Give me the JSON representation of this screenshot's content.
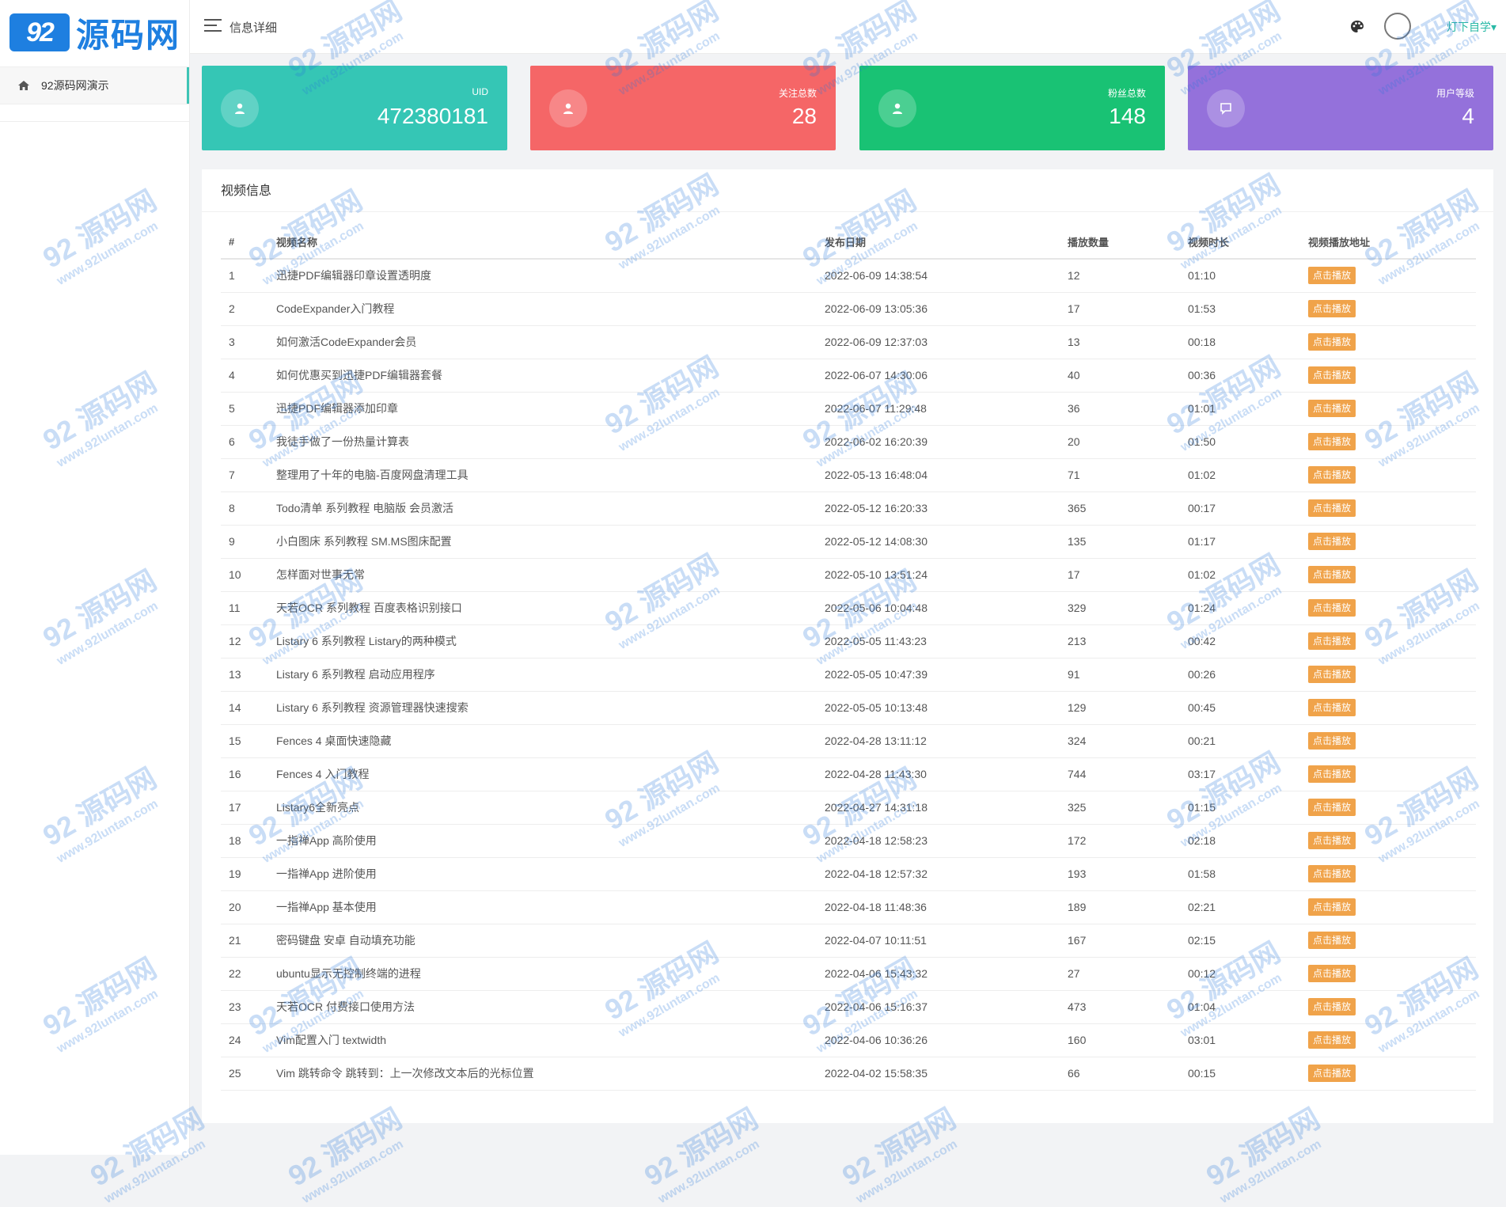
{
  "logo": {
    "badge": "92",
    "text": "源码网"
  },
  "sidebar": {
    "items": [
      {
        "label": "92源码网演示",
        "icon": "home-icon"
      }
    ]
  },
  "header": {
    "title": "信息详细",
    "user_name": "灯下自学▾"
  },
  "stats": [
    {
      "label": "UID",
      "value": "472380181",
      "color": "#35c6b5"
    },
    {
      "label": "关注总数",
      "value": "28",
      "color": "#f56667"
    },
    {
      "label": "粉丝总数",
      "value": "148",
      "color": "#19c274"
    },
    {
      "label": "用户等级",
      "value": "4",
      "color": "#9471db"
    }
  ],
  "panel": {
    "title": "视频信息",
    "columns": [
      "#",
      "视频名称",
      "发布日期",
      "播放数量",
      "视频时长",
      "视频播放地址"
    ],
    "play_label": "点击播放",
    "rows": [
      [
        "1",
        "迅捷PDF编辑器印章设置透明度",
        "2022-06-09 14:38:54",
        "12",
        "01:10"
      ],
      [
        "2",
        "CodeExpander入门教程",
        "2022-06-09 13:05:36",
        "17",
        "01:53"
      ],
      [
        "3",
        "如何激活CodeExpander会员",
        "2022-06-09 12:37:03",
        "13",
        "00:18"
      ],
      [
        "4",
        "如何优惠买到迅捷PDF编辑器套餐",
        "2022-06-07 14:30:06",
        "40",
        "00:36"
      ],
      [
        "5",
        "迅捷PDF编辑器添加印章",
        "2022-06-07 11:29:48",
        "36",
        "01:01"
      ],
      [
        "6",
        "我徒手做了一份热量计算表",
        "2022-06-02 16:20:39",
        "20",
        "01:50"
      ],
      [
        "7",
        "整理用了十年的电脑-百度网盘清理工具",
        "2022-05-13 16:48:04",
        "71",
        "01:02"
      ],
      [
        "8",
        "Todo清单 系列教程 电脑版 会员激活",
        "2022-05-12 16:20:33",
        "365",
        "00:17"
      ],
      [
        "9",
        "小白图床 系列教程 SM.MS图床配置",
        "2022-05-12 14:08:30",
        "135",
        "01:17"
      ],
      [
        "10",
        "怎样面对世事无常",
        "2022-05-10 13:51:24",
        "17",
        "01:02"
      ],
      [
        "11",
        "天若OCR 系列教程 百度表格识别接口",
        "2022-05-06 10:04:48",
        "329",
        "01:24"
      ],
      [
        "12",
        "Listary 6 系列教程 Listary的两种模式",
        "2022-05-05 11:43:23",
        "213",
        "00:42"
      ],
      [
        "13",
        "Listary 6 系列教程 启动应用程序",
        "2022-05-05 10:47:39",
        "91",
        "00:26"
      ],
      [
        "14",
        "Listary 6 系列教程 资源管理器快速搜索",
        "2022-05-05 10:13:48",
        "129",
        "00:45"
      ],
      [
        "15",
        "Fences 4 桌面快速隐藏",
        "2022-04-28 13:11:12",
        "324",
        "00:21"
      ],
      [
        "16",
        "Fences 4 入门教程",
        "2022-04-28 11:43:30",
        "744",
        "03:17"
      ],
      [
        "17",
        "Listary6全新亮点",
        "2022-04-27 14:31:18",
        "325",
        "01:15"
      ],
      [
        "18",
        "一指禅App 高阶使用",
        "2022-04-18 12:58:23",
        "172",
        "02:18"
      ],
      [
        "19",
        "一指禅App 进阶使用",
        "2022-04-18 12:57:32",
        "193",
        "01:58"
      ],
      [
        "20",
        "一指禅App 基本使用",
        "2022-04-18 11:48:36",
        "189",
        "02:21"
      ],
      [
        "21",
        "密码键盘 安卓 自动填充功能",
        "2022-04-07 10:11:51",
        "167",
        "02:15"
      ],
      [
        "22",
        "ubuntu显示无控制终端的进程",
        "2022-04-06 15:43:32",
        "27",
        "00:12"
      ],
      [
        "23",
        "天若OCR 付费接口使用方法",
        "2022-04-06 15:16:37",
        "473",
        "01:04"
      ],
      [
        "24",
        "Vim配置入门 textwidth",
        "2022-04-06 10:36:26",
        "160",
        "03:01"
      ],
      [
        "25",
        "Vim 跳转命令 跳转到：上一次修改文本后的光标位置",
        "2022-04-02 15:58:35",
        "66",
        "00:15"
      ]
    ]
  },
  "watermark": {
    "text": "92 源码网",
    "url": "www.92luntan.com"
  }
}
